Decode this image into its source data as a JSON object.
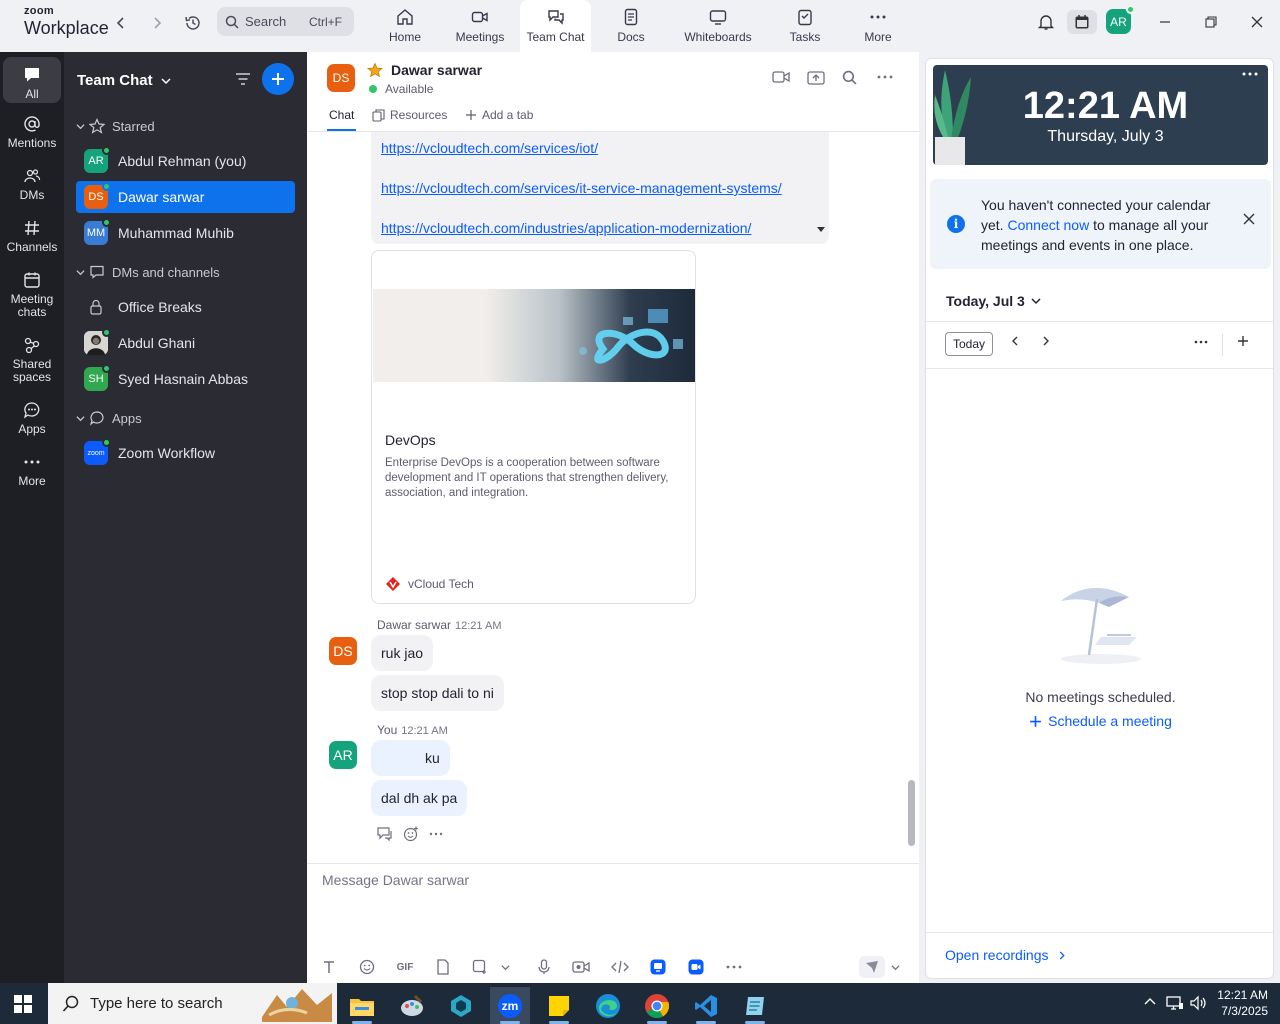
{
  "topbar": {
    "logo_small": "zoom",
    "logo_big": "Workplace",
    "search_placeholder": "Search",
    "search_shortcut": "Ctrl+F",
    "tabs": [
      "Home",
      "Meetings",
      "Team Chat",
      "Docs",
      "Whiteboards",
      "Tasks",
      "More"
    ],
    "active_tab": "Team Chat",
    "user_initials": "AR"
  },
  "rail": {
    "items": [
      "All",
      "Mentions",
      "DMs",
      "Channels",
      "Meeting chats",
      "Shared spaces",
      "Apps",
      "More"
    ]
  },
  "sidebar": {
    "title": "Team Chat",
    "starred_label": "Starred",
    "starred": [
      {
        "initials": "AR",
        "name": "Abdul Rehman (you)",
        "color": "#15a37b"
      },
      {
        "initials": "DS",
        "name": "Dawar sarwar",
        "color": "#e8600f"
      },
      {
        "initials": "MM",
        "name": "Muhammad Muhib",
        "color": "#3a7bd5"
      }
    ],
    "dms_label": "DMs and channels",
    "dms": [
      {
        "name": "Office Breaks",
        "icon": "lock-icon"
      },
      {
        "name": "Abdul Ghani",
        "icon": "photo-avatar"
      },
      {
        "initials": "SH",
        "name": "Syed Hasnain Abbas",
        "color": "#2fa84f"
      }
    ],
    "apps_label": "Apps",
    "apps": [
      {
        "name": "Zoom Workflow",
        "badge": "zoom"
      }
    ]
  },
  "chat": {
    "contact_initials": "DS",
    "contact_name": "Dawar sarwar",
    "status": "Available",
    "tabs": [
      "Chat",
      "Resources",
      "Add a tab"
    ],
    "links": [
      "https://vcloudtech.com/services/iot/",
      "https://vcloudtech.com/services/it-service-management-systems/",
      "https://vcloudtech.com/industries/application-modernization/"
    ],
    "card": {
      "title": "DevOps",
      "description": "Enterprise DevOps is a cooperation between software development and IT operations that strengthen delivery, association, and integration.",
      "source": "vCloud Tech"
    },
    "group1": {
      "sender": "Dawar sarwar",
      "time": "12:21 AM",
      "initials": "DS",
      "messages": [
        "ruk jao",
        "stop stop dali to ni"
      ]
    },
    "group2": {
      "sender": "You",
      "time": "12:21 AM",
      "initials": "AR",
      "messages": [
        "ku",
        "dal dh ak pa"
      ]
    },
    "composer_placeholder": "Message Dawar sarwar",
    "gif_label": "GIF"
  },
  "right_panel": {
    "time": "12:21 AM",
    "date": "Thursday, July 3",
    "notice_part1": "You haven't connected your calendar yet.",
    "notice_link": "Connect now",
    "notice_part2": "to manage all your meetings and events in one place.",
    "today_header": "Today, Jul 3",
    "today_button": "Today",
    "empty_text": "No meetings scheduled.",
    "schedule_link": "Schedule a meeting",
    "open_recordings": "Open recordings"
  },
  "taskbar": {
    "search_placeholder": "Type here to search",
    "time": "12:21 AM",
    "date": "7/3/2025",
    "zoom_label": "zm"
  }
}
